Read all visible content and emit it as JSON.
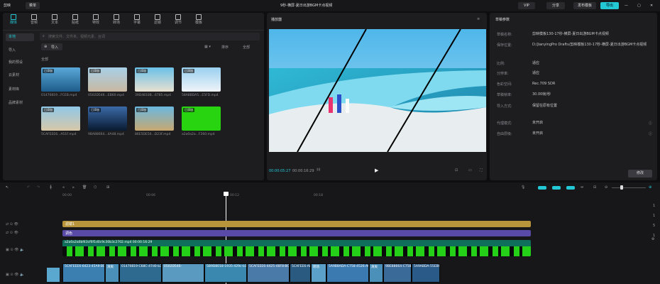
{
  "titlebar": {
    "logo": "剪映",
    "menu": "菜单",
    "title": "9秒-横屏-夏日出游BGM卡点视频",
    "vip": "VIP",
    "share": "分享",
    "publish": "发布模板",
    "export": "导出"
  },
  "toolbar": [
    {
      "label": "媒体",
      "icon": "media-icon"
    },
    {
      "label": "音频",
      "icon": "audio-icon"
    },
    {
      "label": "文本",
      "icon": "text-icon"
    },
    {
      "label": "贴纸",
      "icon": "sticker-icon"
    },
    {
      "label": "特效",
      "icon": "effect-icon"
    },
    {
      "label": "转场",
      "icon": "transition-icon"
    },
    {
      "label": "字幕",
      "icon": "caption-icon"
    },
    {
      "label": "滤镜",
      "icon": "filter-icon"
    },
    {
      "label": "调节",
      "icon": "adjust-icon"
    },
    {
      "label": "模板",
      "icon": "template-icon"
    }
  ],
  "sidebar": {
    "items": [
      "本地",
      "导入",
      "我的预设",
      "云素材",
      "素材库",
      "品牌素材"
    ]
  },
  "media": {
    "search_placeholder": "搜索文件、文件夹、视频元素、台词",
    "import": "导入",
    "sort": "排序",
    "all": "全部",
    "section": "全部",
    "clips": [
      {
        "tag": "已添加",
        "name": "01470819...FCEB.mp4"
      },
      {
        "tag": "已添加",
        "name": "0502D546...EB60.mp4"
      },
      {
        "tag": "已添加",
        "name": "39D4810B...6785.mp4"
      },
      {
        "tag": "已添加",
        "name": "58A8BDA5...E5FD.mp4"
      },
      {
        "tag": "已添加",
        "name": "5CAFEEE6...A51F.mp4"
      },
      {
        "tag": "已添加",
        "name": "9BA88664...4A48.mp4"
      },
      {
        "tag": "已添加",
        "name": "86E5DE56...D23F.mp4"
      },
      {
        "tag": "已添加",
        "name": "a2a0a2a...F260.mp4"
      }
    ]
  },
  "player": {
    "title": "播放器",
    "current": "00:00:05:27",
    "total": "00:00:16:29",
    "colors": {
      "accent": "#22c8d4"
    }
  },
  "draft": {
    "title": "草稿参数",
    "rows": [
      [
        "草稿名称:",
        "剪映模板130-17秒-横屏-夏日出游BGM卡点视频"
      ],
      [
        "保存位置:",
        "D:/JianyingPro Drafts/剪映模板130-17秒-横屏-夏日出游BGM卡点视频"
      ],
      [
        "比例:",
        "适应"
      ],
      [
        "分辨率:",
        "适应"
      ],
      [
        "色彩空间:",
        "Rec.709 SDR"
      ],
      [
        "草稿帧率:",
        "30.00帧/秒"
      ],
      [
        "导入方式:",
        "保留在原有位置"
      ],
      [
        "代理模式:",
        "未开启"
      ],
      [
        "自由层级:",
        "未开启"
      ]
    ],
    "modify": "修改"
  },
  "timeline": {
    "ticks": [
      "00:00",
      "00:06",
      "00:12",
      "00:18"
    ],
    "track1": "滤镜1",
    "track2": "调色",
    "green_clip": "a2a0a2a0bf43cf6f1d0c9c30b3c2702.mp4 00:00:16:29",
    "clips": [
      "5CAFEEE6-6423-45A9-BC97-1CC",
      "清爽",
      "01470819-C68C-47d0-b3f",
      "0502D546-",
      "5B9D8018-1935-429c-b15",
      "5CAFEEE6-4425-48F8-BC97",
      "5CAFEE6-ABEFFABE",
      "转场",
      "5A9B8ADA-C758-4526-AC8",
      "清爽",
      "9BE88664-C758-45E0",
      "5A9ABDA-55EB6"
    ],
    "right_vals": [
      "1",
      "1",
      "5",
      "1"
    ]
  }
}
